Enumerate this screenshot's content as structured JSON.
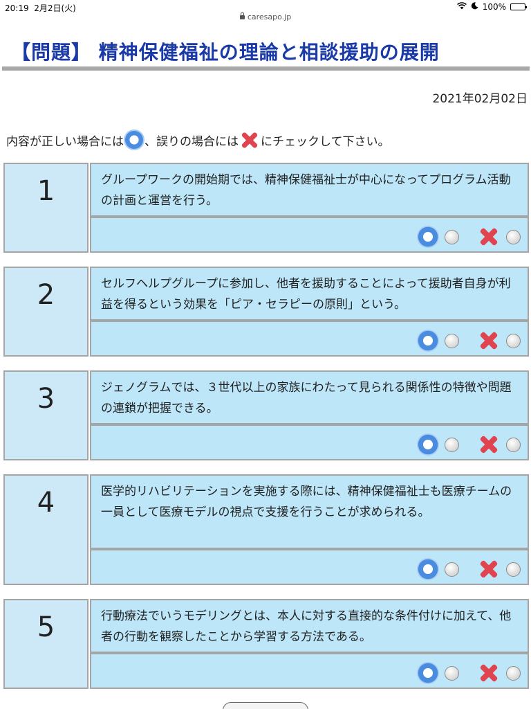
{
  "status_bar": {
    "time": "20:19",
    "date": "2月2日(火)",
    "battery": "100%",
    "battery_level": 1.0
  },
  "browser": {
    "url": "caresapo.jp"
  },
  "page": {
    "title": "【問題】 精神保健福祉の理論と相談援助の展開",
    "date": "2021年02月02日",
    "instruction_before": "内容が正しい場合には",
    "instruction_middle": "、誤りの場合には",
    "instruction_after": "にチェックして下さい。"
  },
  "questions": [
    {
      "number": "1",
      "text": "グループワークの開始期では、精神保健福祉士が中心になってプログラム活動の計画と運営を行う。"
    },
    {
      "number": "2",
      "text": "セルフヘルプグループに参加し、他者を援助することによって援助者自身が利益を得るという効果を「ピア・セラピーの原則」という。"
    },
    {
      "number": "3",
      "text": "ジェノグラムでは、３世代以上の家族にわたって見られる関係性の特徴や問題の連鎖が把握できる。"
    },
    {
      "number": "4",
      "text": "医学的リハビリテーションを実施する際には、精神保健福祉士も医療チームの一員として医療モデルの視点で支援を行うことが求められる。"
    },
    {
      "number": "5",
      "text": "行動療法でいうモデリングとは、本人に対する直接的な条件付けに加えて、他者の行動を観察したことから学習する方法である。"
    }
  ],
  "icons": {
    "correct": "correct-ring-icon",
    "incorrect": "cross-icon"
  },
  "colors": {
    "title": "#1a3aa8",
    "panel": "#bde6f9",
    "number_panel": "#cde9f8",
    "border": "#a5a5a5",
    "cross": "#e0454f",
    "ring": "#4a8de0"
  }
}
